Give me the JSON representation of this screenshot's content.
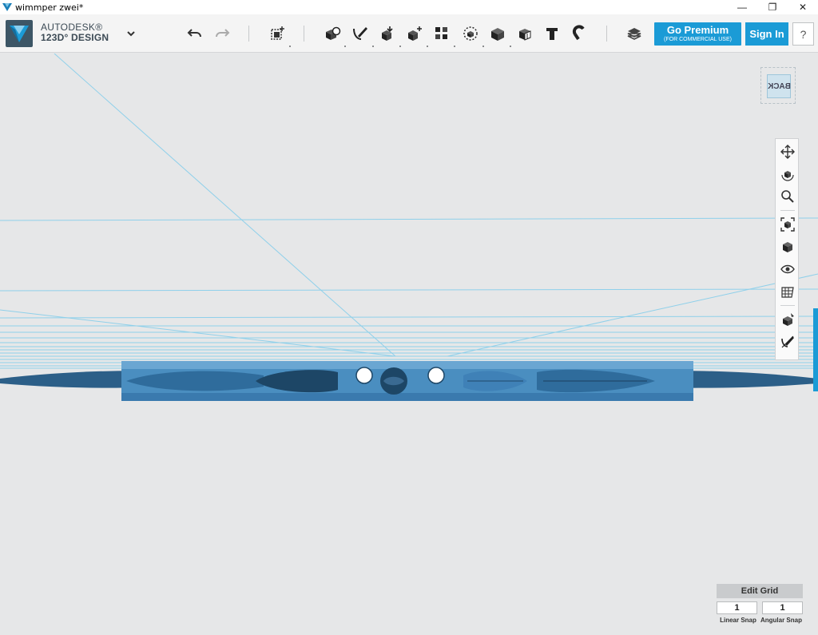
{
  "window": {
    "title": "wimmper zwei*"
  },
  "brand": {
    "line1": "AUTODESK®",
    "line2": "123D° DESIGN"
  },
  "toolbar": {
    "premium_label": "Go Premium",
    "premium_sub": "(FOR COMMERCIAL USE)",
    "signin_label": "Sign In",
    "help_label": "?"
  },
  "viewcube": {
    "face_label": "BACK"
  },
  "edit_grid": {
    "button_label": "Edit Grid",
    "linear_snap_value": "1",
    "angular_snap_value": "1",
    "linear_snap_label": "Linear Snap",
    "angular_snap_label": "Angular Snap"
  },
  "colors": {
    "accent": "#1b9bd6",
    "model": "#4a8ec0",
    "grid": "#8fd0ea"
  }
}
